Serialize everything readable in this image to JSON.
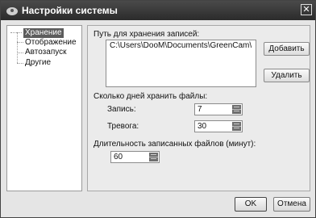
{
  "window": {
    "title": "Настройки системы",
    "close_glyph": "✕"
  },
  "nav": {
    "items": [
      {
        "label": "Хранение",
        "selected": true
      },
      {
        "label": "Отображение"
      },
      {
        "label": "Автозапуск"
      },
      {
        "label": "Другие"
      }
    ]
  },
  "storage": {
    "path_label": "Путь для хранения записей:",
    "path_value": "C:\\Users\\DooM\\Documents\\GreenCam\\",
    "add_label": "Добавить",
    "delete_label": "Удалить",
    "days_label": "Сколько дней хранить файлы:",
    "record_label": "Запись:",
    "record_value": "7",
    "alarm_label": "Тревога:",
    "alarm_value": "30",
    "duration_label": "Длительность записанных файлов (минут):",
    "duration_value": "60"
  },
  "footer": {
    "ok_label": "OK",
    "cancel_label": "Отмена"
  },
  "icons": {
    "app": "gear-icon",
    "close": "close-icon",
    "spin": "spin-arrows-icon"
  }
}
